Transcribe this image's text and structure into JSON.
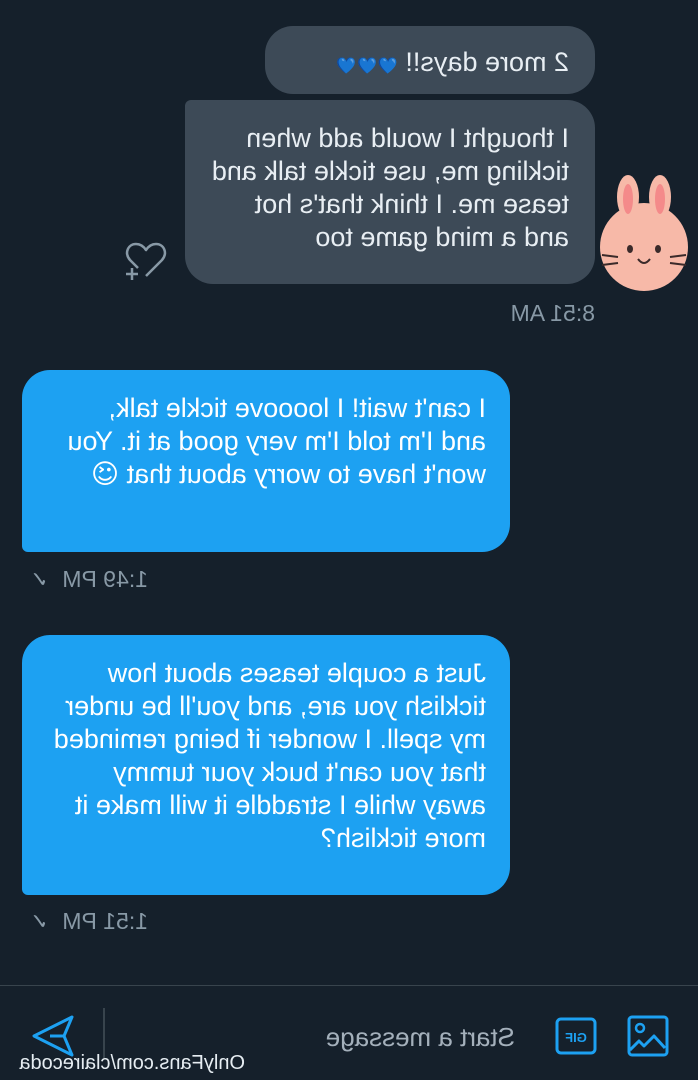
{
  "conversation": {
    "messages": [
      {
        "sender": "other",
        "text": "2 more days!! ",
        "emoji": "💙💙💙"
      },
      {
        "sender": "other",
        "text": "I thought I would add when tickling me, use tickle talk and tease me. I think that's hot and a mind game too",
        "timestamp": "8:51 AM"
      },
      {
        "sender": "self",
        "text": "I can't wait! I loooove tickle talk, and I'm told I'm very good at it. You won't have to worry about that ",
        "emoji": "😉",
        "timestamp": "1:49 PM",
        "status": "✓"
      },
      {
        "sender": "self",
        "text": "Just a couple teases about how ticklish you are, and you'll be under my spell. I wonder if being reminded that you can't buck your tummy away while I straddle it will make it more ticklish?",
        "timestamp": "1:51 PM",
        "status": "✓"
      }
    ]
  },
  "composer": {
    "placeholder": "Start a message",
    "gif_label": "GIF",
    "icons": [
      "image-icon",
      "gif-icon",
      "send-icon"
    ]
  },
  "avatar": {
    "icon": "bunny-avatar"
  },
  "watermark": "OnlyFans.com/clairecoda",
  "colors": {
    "background": "#15202b",
    "bubble_other": "#3d4a57",
    "bubble_self": "#1da1f2",
    "accent": "#1da1f2",
    "timestamp": "#8899a6"
  }
}
